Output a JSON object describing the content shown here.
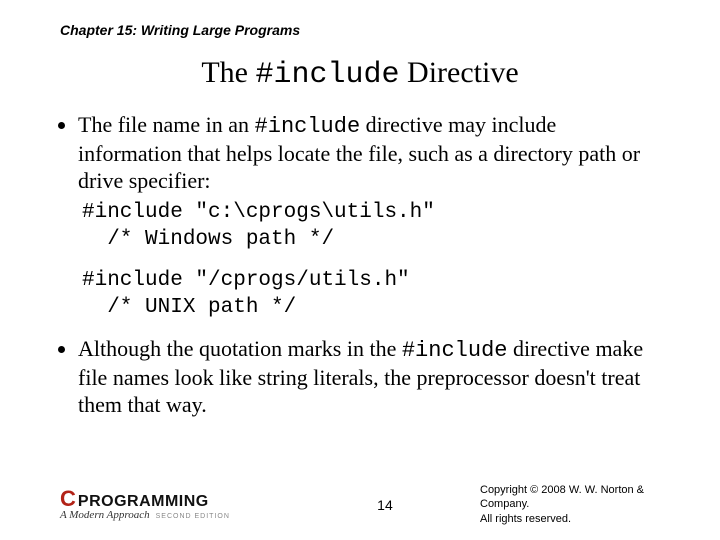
{
  "chapter": "Chapter 15: Writing Large Programs",
  "title_pre": "The ",
  "title_code": "#include",
  "title_post": " Directive",
  "bullet1_a": "The file name in an ",
  "bullet1_code": "#include",
  "bullet1_b": " directive may include information that helps locate the file, such as a directory path or drive specifier:",
  "code1_line1": "#include \"c:\\cprogs\\utils.h\"",
  "code1_line2": "  /* Windows path */",
  "code2_line1": "#include \"/cprogs/utils.h\"",
  "code2_line2": "  /* UNIX path */",
  "bullet2_a": "Although the quotation marks in the ",
  "bullet2_code": "#include",
  "bullet2_b": " directive make file names look like string literals, the preprocessor doesn't treat them that way.",
  "logo_c": "C",
  "logo_word": "PROGRAMMING",
  "logo_sub": "A Modern Approach",
  "logo_edition": "SECOND EDITION",
  "page_num": "14",
  "copyright_l1": "Copyright © 2008 W. W. Norton & Company.",
  "copyright_l2": "All rights reserved."
}
